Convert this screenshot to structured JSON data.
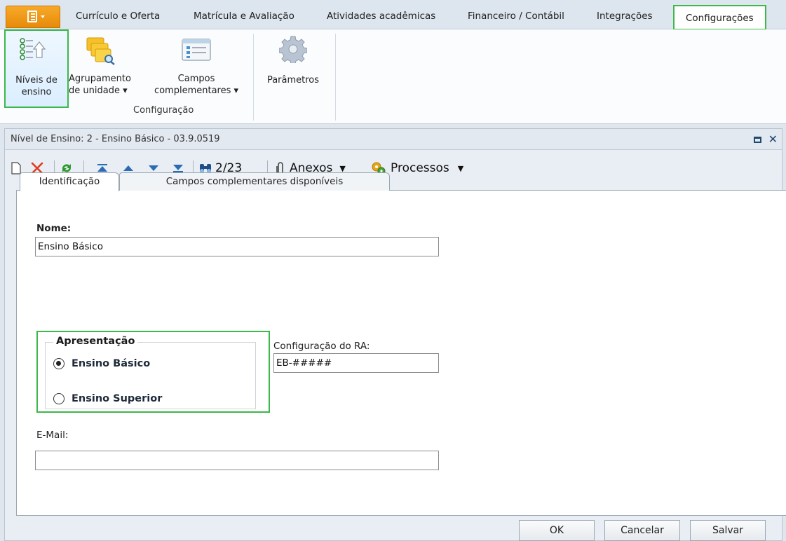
{
  "ribbon_tabs": [
    "Currículo e Oferta",
    "Matrícula e Avaliação",
    "Atividades acadêmicas",
    "Financeiro / Contábil",
    "Integrações",
    "Configurações"
  ],
  "ribbon": {
    "niveis_line1": "Níveis de",
    "niveis_line2": "ensino",
    "agrup_line1": "Agrupamento",
    "agrup_line2": "de unidade ▾",
    "campos_line1": "Campos",
    "campos_line2": "complementares ▾",
    "parametros": "Parâmetros",
    "group_label": "Configuração"
  },
  "document": {
    "title": "Nível de Ensino: 2 - Ensino Básico - 03.9.0519"
  },
  "toolbar": {
    "record_counter": "2/23",
    "anexos_label": "Anexos",
    "processos_label": "Processos"
  },
  "form_tabs": [
    "Identificação",
    "Campos complementares disponíveis"
  ],
  "form": {
    "nome_label": "Nome:",
    "nome_value": "Ensino Básico",
    "apresentacao_title": "Apresentação",
    "radio_basico": "Ensino Básico",
    "radio_superior": "Ensino Superior",
    "ra_label": "Configuração do RA:",
    "ra_value": "EB-#####",
    "email_label": "E-Mail:",
    "email_value": ""
  },
  "buttons": {
    "ok": "OK",
    "cancelar": "Cancelar",
    "salvar": "Salvar"
  },
  "colors": {
    "highlight": "#3db84a",
    "app_button": "#f0990f",
    "delete_icon": "#e03a1e"
  }
}
